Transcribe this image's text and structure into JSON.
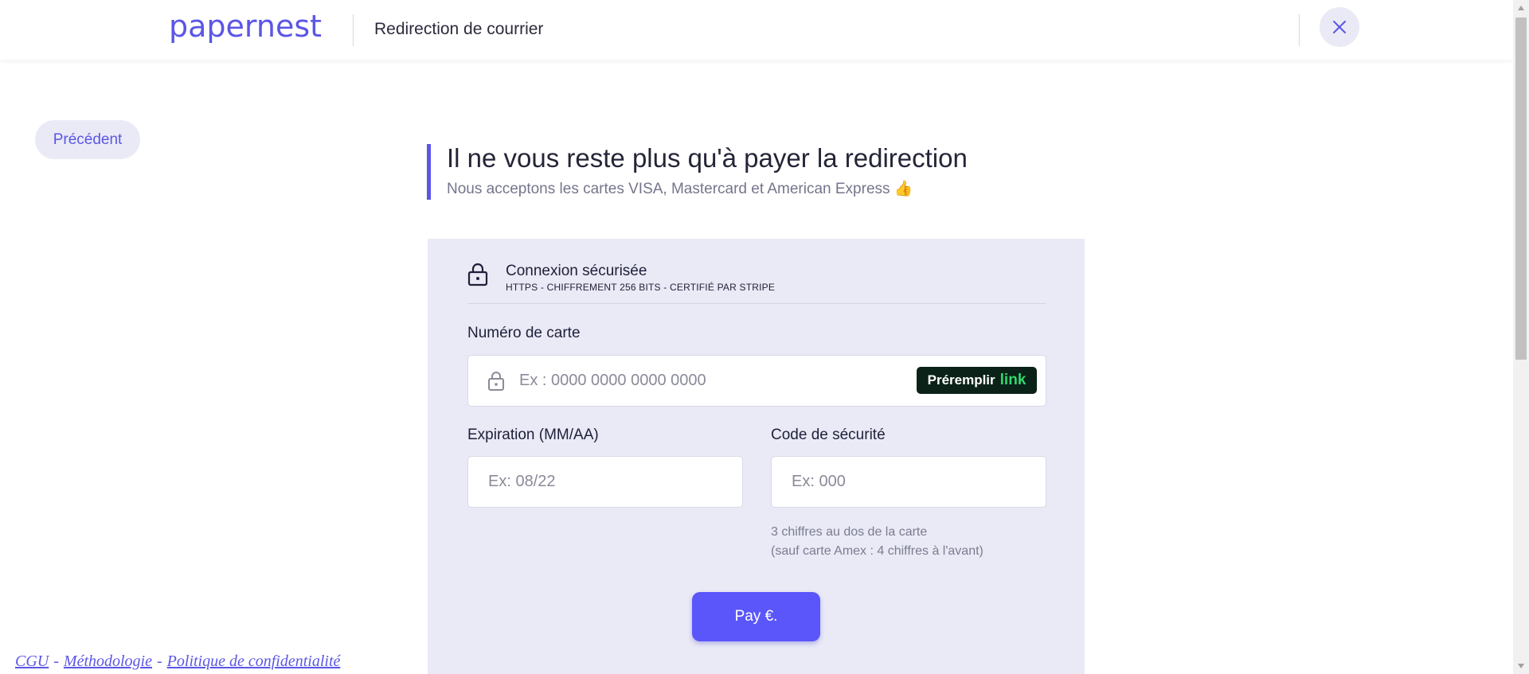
{
  "header": {
    "logo_text": "papernest",
    "title": "Redirection de courrier",
    "close_icon": "close-icon"
  },
  "nav": {
    "prev_label": "Précédent"
  },
  "page": {
    "title": "Il ne vous reste plus qu'à payer la redirection",
    "subtitle": "Nous acceptons les cartes VISA, Mastercard et American Express 👍"
  },
  "payment": {
    "secure_title": "Connexion sécurisée",
    "secure_subtitle": "HTTPS - CHIFFREMENT 256 BITS - CERTIFIÉ PAR STRIPE",
    "card_number_label": "Numéro de carte",
    "card_number_placeholder": "Ex : 0000 0000 0000 0000",
    "link_prefill_label": "Préremplir",
    "link_brand": "link",
    "expiration_label": "Expiration (MM/AA)",
    "expiration_placeholder": "Ex: 08/22",
    "cvc_label": "Code de sécurité",
    "cvc_placeholder": "Ex: 000",
    "cvc_hint_line1": "3 chiffres au dos de la carte",
    "cvc_hint_line2": "(sauf carte Amex : 4 chiffres à l'avant)",
    "pay_label": "Pay €."
  },
  "footer": {
    "links": [
      "CGU",
      "Méthodologie",
      "Politique de confidentialité"
    ],
    "separator": "-"
  },
  "colors": {
    "accent": "#5b56e6",
    "card_bg": "#e9eaf5",
    "link_bg": "#0b2218",
    "link_green": "#33d66e",
    "pay_bg": "#5b56fa"
  }
}
